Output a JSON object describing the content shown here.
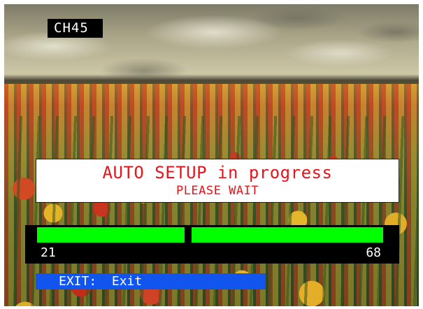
{
  "osd": {
    "channel_label": "CH45",
    "message": {
      "title": "AUTO SETUP in progress",
      "subtitle": "PLEASE WAIT"
    },
    "progress": {
      "range_start": "21",
      "range_end": "68",
      "fill_fraction": 1.0,
      "bar_color": "#00ff00"
    },
    "exit_hint": {
      "key": "EXIT:",
      "action": "Exit",
      "color": "#1155ee"
    },
    "message_text_color": "#e8141a"
  }
}
